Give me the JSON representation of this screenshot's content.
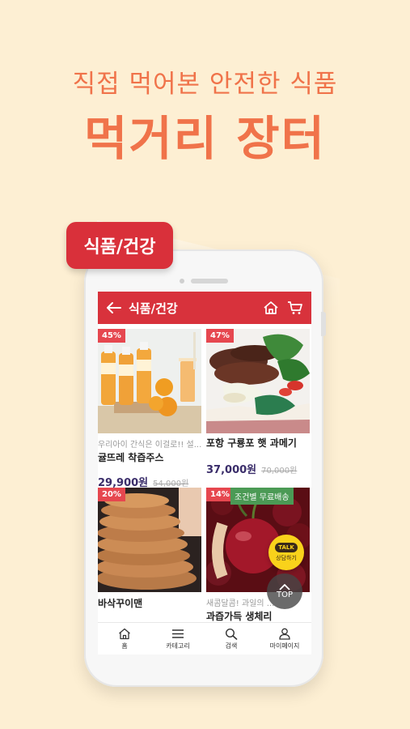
{
  "promo": {
    "subtitle": "직접 먹어본 안전한 식품",
    "title": "먹거리 장터",
    "category_tag": "식품/건강"
  },
  "appbar": {
    "title": "식품/건강",
    "back_icon": "arrow-left-icon",
    "home_icon": "home-icon",
    "cart_icon": "cart-icon"
  },
  "products": [
    {
      "discount": "45%",
      "subtitle": "우리아이 간식은 이걸로!! 설...",
      "name": "귤뜨레 착즙주스",
      "price": "29,900원",
      "original_price": "54,000원"
    },
    {
      "discount": "47%",
      "subtitle": "",
      "name": "포항 구룡포 햇 과메기",
      "price": "37,000원",
      "original_price": "70,000원"
    },
    {
      "discount": "20%",
      "subtitle": "",
      "name": "바삭꾸이맨",
      "price": "",
      "original_price": ""
    },
    {
      "discount": "14%",
      "shipping_badge": "조건별 무료배송",
      "subtitle": "새콤달콤! 과일의 ...",
      "name": "과즙가득 생체리",
      "price": "",
      "original_price": ""
    }
  ],
  "floating": {
    "talk_bubble": "TALK",
    "talk_label": "상담하기",
    "top_label": "TOP"
  },
  "bottom_nav": [
    {
      "label": "홈",
      "icon": "home-icon"
    },
    {
      "label": "카테고리",
      "icon": "menu-icon"
    },
    {
      "label": "검색",
      "icon": "search-icon"
    },
    {
      "label": "마이페이지",
      "icon": "user-icon"
    }
  ],
  "colors": {
    "background": "#fdefd3",
    "headline": "#f0734a",
    "brand_red": "#d8323c",
    "price": "#3a2d6a"
  }
}
